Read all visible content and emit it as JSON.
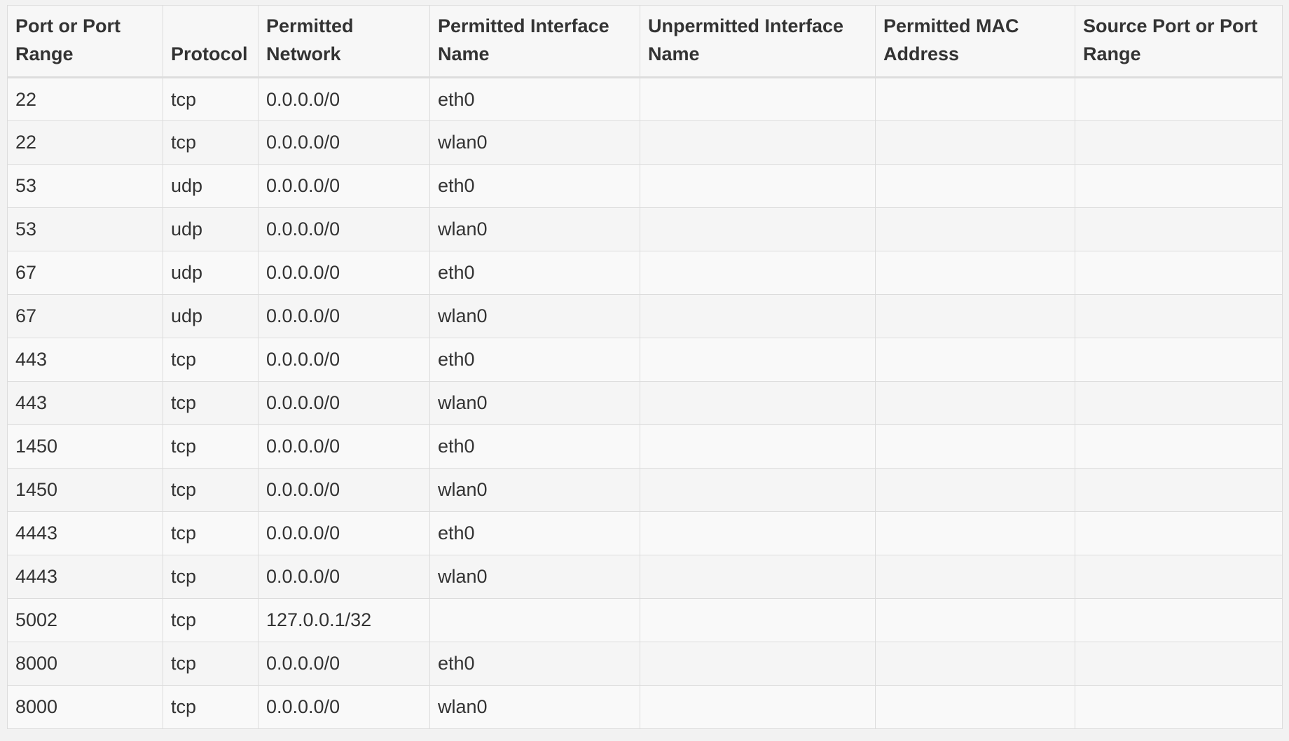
{
  "table": {
    "headers": [
      "Port or Port Range",
      "Protocol",
      "Permitted Network",
      "Permitted Interface Name",
      "Unpermitted Interface Name",
      "Permitted MAC Address",
      "Source Port or Port Range"
    ],
    "rows": [
      [
        "22",
        "tcp",
        "0.0.0.0/0",
        "eth0",
        "",
        "",
        ""
      ],
      [
        "22",
        "tcp",
        "0.0.0.0/0",
        "wlan0",
        "",
        "",
        ""
      ],
      [
        "53",
        "udp",
        "0.0.0.0/0",
        "eth0",
        "",
        "",
        ""
      ],
      [
        "53",
        "udp",
        "0.0.0.0/0",
        "wlan0",
        "",
        "",
        ""
      ],
      [
        "67",
        "udp",
        "0.0.0.0/0",
        "eth0",
        "",
        "",
        ""
      ],
      [
        "67",
        "udp",
        "0.0.0.0/0",
        "wlan0",
        "",
        "",
        ""
      ],
      [
        "443",
        "tcp",
        "0.0.0.0/0",
        "eth0",
        "",
        "",
        ""
      ],
      [
        "443",
        "tcp",
        "0.0.0.0/0",
        "wlan0",
        "",
        "",
        ""
      ],
      [
        "1450",
        "tcp",
        "0.0.0.0/0",
        "eth0",
        "",
        "",
        ""
      ],
      [
        "1450",
        "tcp",
        "0.0.0.0/0",
        "wlan0",
        "",
        "",
        ""
      ],
      [
        "4443",
        "tcp",
        "0.0.0.0/0",
        "eth0",
        "",
        "",
        ""
      ],
      [
        "4443",
        "tcp",
        "0.0.0.0/0",
        "wlan0",
        "",
        "",
        ""
      ],
      [
        "5002",
        "tcp",
        "127.0.0.1/32",
        "",
        "",
        "",
        ""
      ],
      [
        "8000",
        "tcp",
        "0.0.0.0/0",
        "eth0",
        "",
        "",
        ""
      ],
      [
        "8000",
        "tcp",
        "0.0.0.0/0",
        "wlan0",
        "",
        "",
        ""
      ]
    ]
  }
}
